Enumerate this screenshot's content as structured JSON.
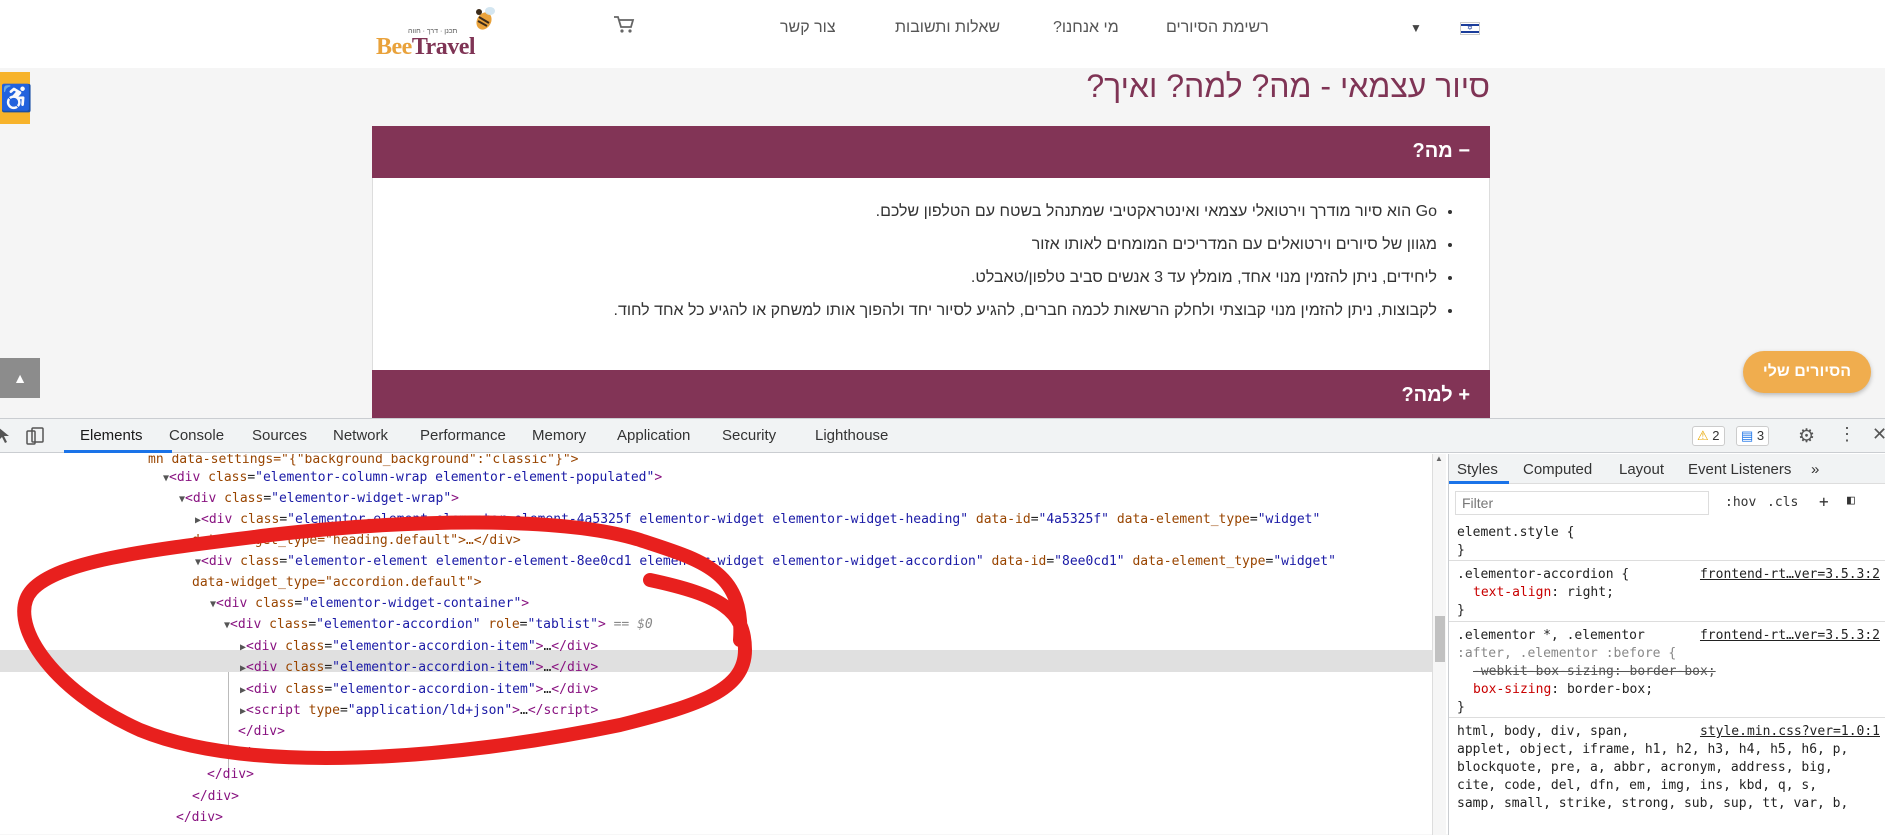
{
  "site": {
    "logo": {
      "brand_part1": "Bee",
      "brand_part2": "Travel",
      "tagline": "תכנן · דרך · חווה"
    },
    "nav": {
      "tours_list": "רשימת הסיורים",
      "about": "מי אנחנו?",
      "faq": "שאלות ותשובות",
      "contact": "צור קשר"
    },
    "page_title": "סיור עצמאי - מה? למה? ואיך?",
    "accordion": [
      {
        "title": "מה?",
        "icon": "−",
        "expanded": true,
        "items": [
          "Go הוא סיור מודרך וירטואלי עצמאי ואינטראקטיבי שמתנהל בשטח עם הטלפון שלכם.",
          "מגוון של סיורים וירטואלים עם המדריכים המומחים לאותו אזור",
          "ליחידים, ניתן להזמין מנוי אחד, מומלץ עד 3 אנשים סביב טלפון/טאבלט.",
          "לקבוצות, ניתן להזמין מנוי קבוצתי ולחלק הרשאות לכמה חברים, להגיע לסיור יחד ולהפוך אותו למשחק או להגיע כל אחד לחוד."
        ]
      },
      {
        "title": "למה?",
        "icon": "+",
        "expanded": false
      }
    ],
    "my_tours_button": "הסיורים שלי",
    "colors": {
      "accent": "#823456",
      "button": "#f0ad4e",
      "accessibility": "#f7b32b"
    }
  },
  "devtools": {
    "tabs": [
      "Elements",
      "Console",
      "Sources",
      "Network",
      "Performance",
      "Memory",
      "Application",
      "Security",
      "Lighthouse"
    ],
    "active_tab": "Elements",
    "warnings_count": "2",
    "messages_count": "3",
    "dom": {
      "l0": "mn  data-settings=\"{\"background_background\":\"classic\"}\">",
      "l1_tag": "div",
      "l1_class": "elementor-column-wrap elementor-element-populated",
      "l2_class": "elementor-widget-wrap",
      "l3_class": "elementor-element elementor-element-4a5325f elementor-widget elementor-widget-heading",
      "l3_id": "4a5325f",
      "l3_type": "widget",
      "l4_text": "data-widget_type=\"heading.default\">…</div>",
      "l5_class": "elementor-element elementor-element-8ee0cd1 elementor-widget elementor-widget-accordion",
      "l5_id": "8ee0cd1",
      "l5_type": "widget",
      "l6_text": "data-widget_type=\"accordion.default\">",
      "l7_class": "elementor-widget-container",
      "l8_class": "elementor-accordion",
      "l8_role": "tablist",
      "l8_marker": "== $0",
      "item_class": "elementor-accordion-item",
      "script_type": "application/ld+json",
      "close_div": "</div>"
    },
    "styles": {
      "tabs": [
        "Styles",
        "Computed",
        "Layout",
        "Event Listeners",
        "»"
      ],
      "filter_placeholder": "Filter",
      "hov": ":hov",
      "cls": ".cls",
      "rules": [
        {
          "selector": "element.style {",
          "close": "}"
        },
        {
          "selector": ".elementor-accordion {",
          "source": "frontend-rt…ver=3.5.3:2",
          "prop": "text-align",
          "value": "right;",
          "close": "}"
        },
        {
          "selector_line1": ".elementor *, .elementor",
          "selector_line2": ":after, .elementor :before {",
          "source": "frontend-rt…ver=3.5.3:2",
          "prop1": "-webkit-box-sizing",
          "value1": "border-box;",
          "prop2": "box-sizing",
          "value2": "border-box;",
          "close": "}"
        },
        {
          "selector_line1": "html, body, div, span,",
          "source": "style.min.css?ver=1.0:1",
          "line2": "applet, object, iframe, h1, h2, h3, h4, h5, h6, p,",
          "line3": "blockquote, pre, a, abbr, acronym, address, big,",
          "line4": "cite, code, del, dfn, em, img, ins, kbd, q, s,",
          "line5": "samp, small, strike, strong, sub, sup, tt, var, b,"
        }
      ]
    }
  }
}
